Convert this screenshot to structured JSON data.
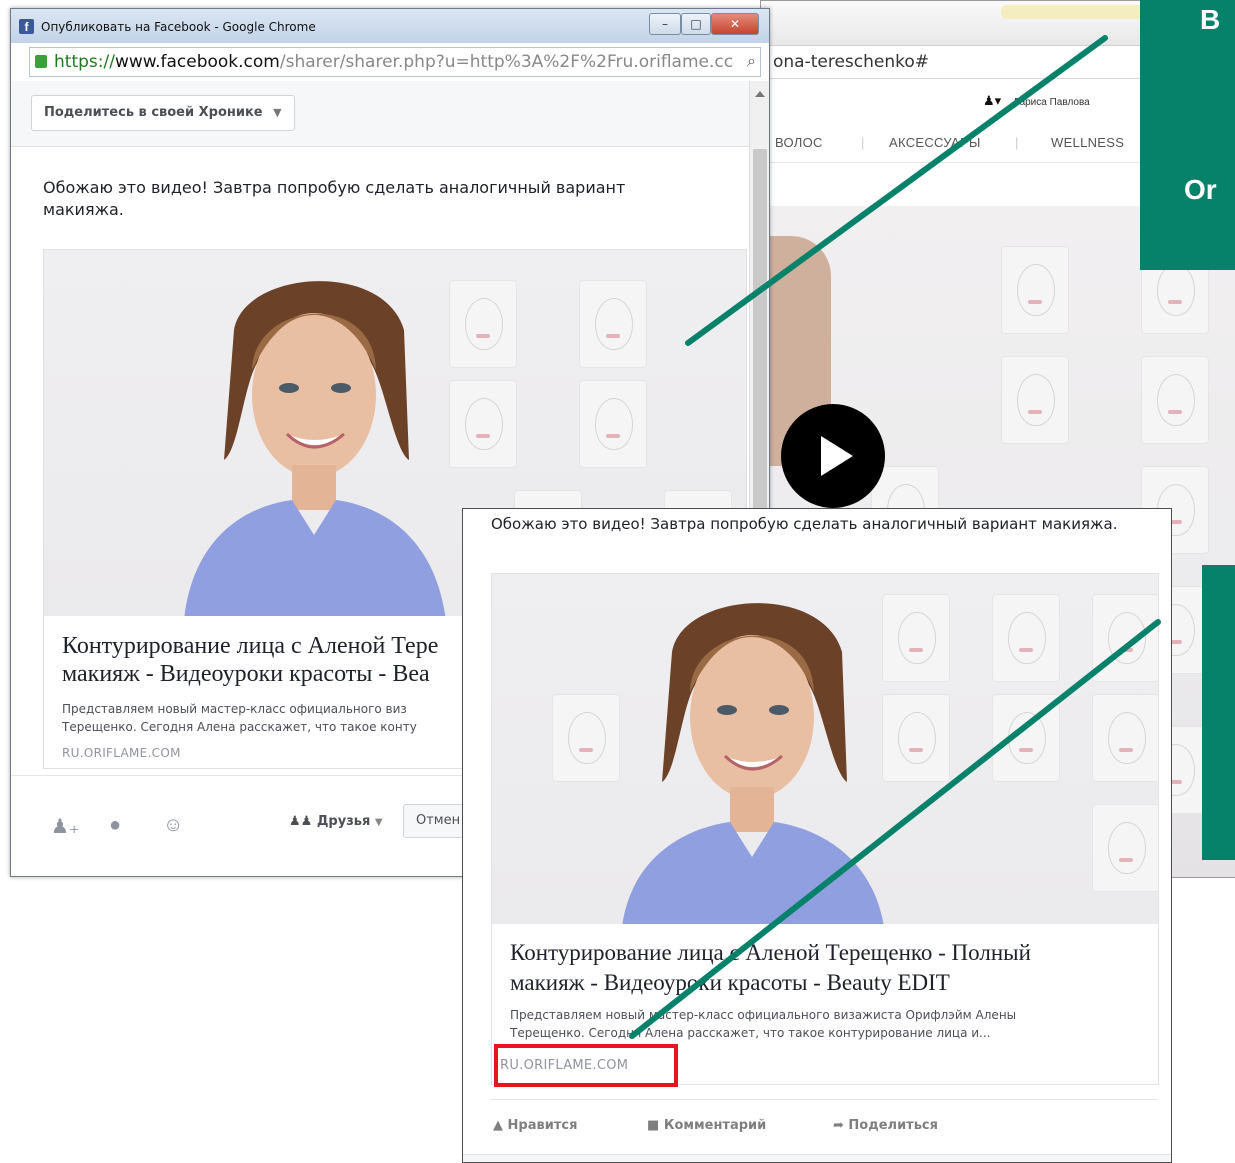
{
  "background_page": {
    "url_text": "ona-tereschenko#",
    "user_name": "Лариса Павлова",
    "nav": [
      "ВОЛОС",
      "АКСЕССУАРЫ",
      "WELLNESS"
    ]
  },
  "callouts": {
    "top_line1": "В",
    "top_line2": "Or",
    "colors": {
      "green": "#07826a",
      "red_frame": "#e8141f"
    }
  },
  "popup": {
    "window_title": "Опубликовать на Facebook - Google Chrome",
    "url": {
      "protocol": "https://",
      "host": "www.facebook.com",
      "path": "/sharer/sharer.php?u=http%3A%2F%2Fru.oriflame.cc"
    },
    "share_target": "Поделитесь в своей Хронике",
    "message": "Обожаю это видео! Завтра попробую сделать аналогичный вариант макияжа.",
    "card": {
      "title_line1": "Контурирование лица с Аленой Тере",
      "title_line2": "макияж - Видеоуроки красоты - Bea",
      "desc_line1": "Представляем новый мастер-класс официального виз",
      "desc_line2": "Терещенко. Сегодня Алена расскажет, что такое конту",
      "source": "RU.ORIFLAME.COM"
    },
    "audience": "Друзья",
    "cancel_label": "Отмен"
  },
  "post": {
    "message": "Обожаю это видео! Завтра попробую сделать аналогичный вариант макияжа.",
    "card": {
      "title_line1": "Контурирование лица с Аленой Терещенко - Полный",
      "title_line2": "макияж - Видеоуроки красоты - Beauty EDIT",
      "desc_line1": "Представляем новый мастер-класс официального визажиста Орифлэйм Алены",
      "desc_line2": "Терещенко. Сегодня Алена расскажет, что такое контурирование лица и...",
      "source": "RU.ORIFLAME.COM"
    },
    "actions": {
      "like": "Нравится",
      "comment": "Комментарий",
      "share": "Поделиться"
    }
  },
  "icons": [
    "facebook-icon",
    "lock-icon",
    "zoom-icon",
    "user-icon",
    "tag-friend-icon",
    "location-icon",
    "emoji-icon",
    "friends-icon",
    "like-icon",
    "comment-icon",
    "share-icon",
    "play-icon"
  ]
}
